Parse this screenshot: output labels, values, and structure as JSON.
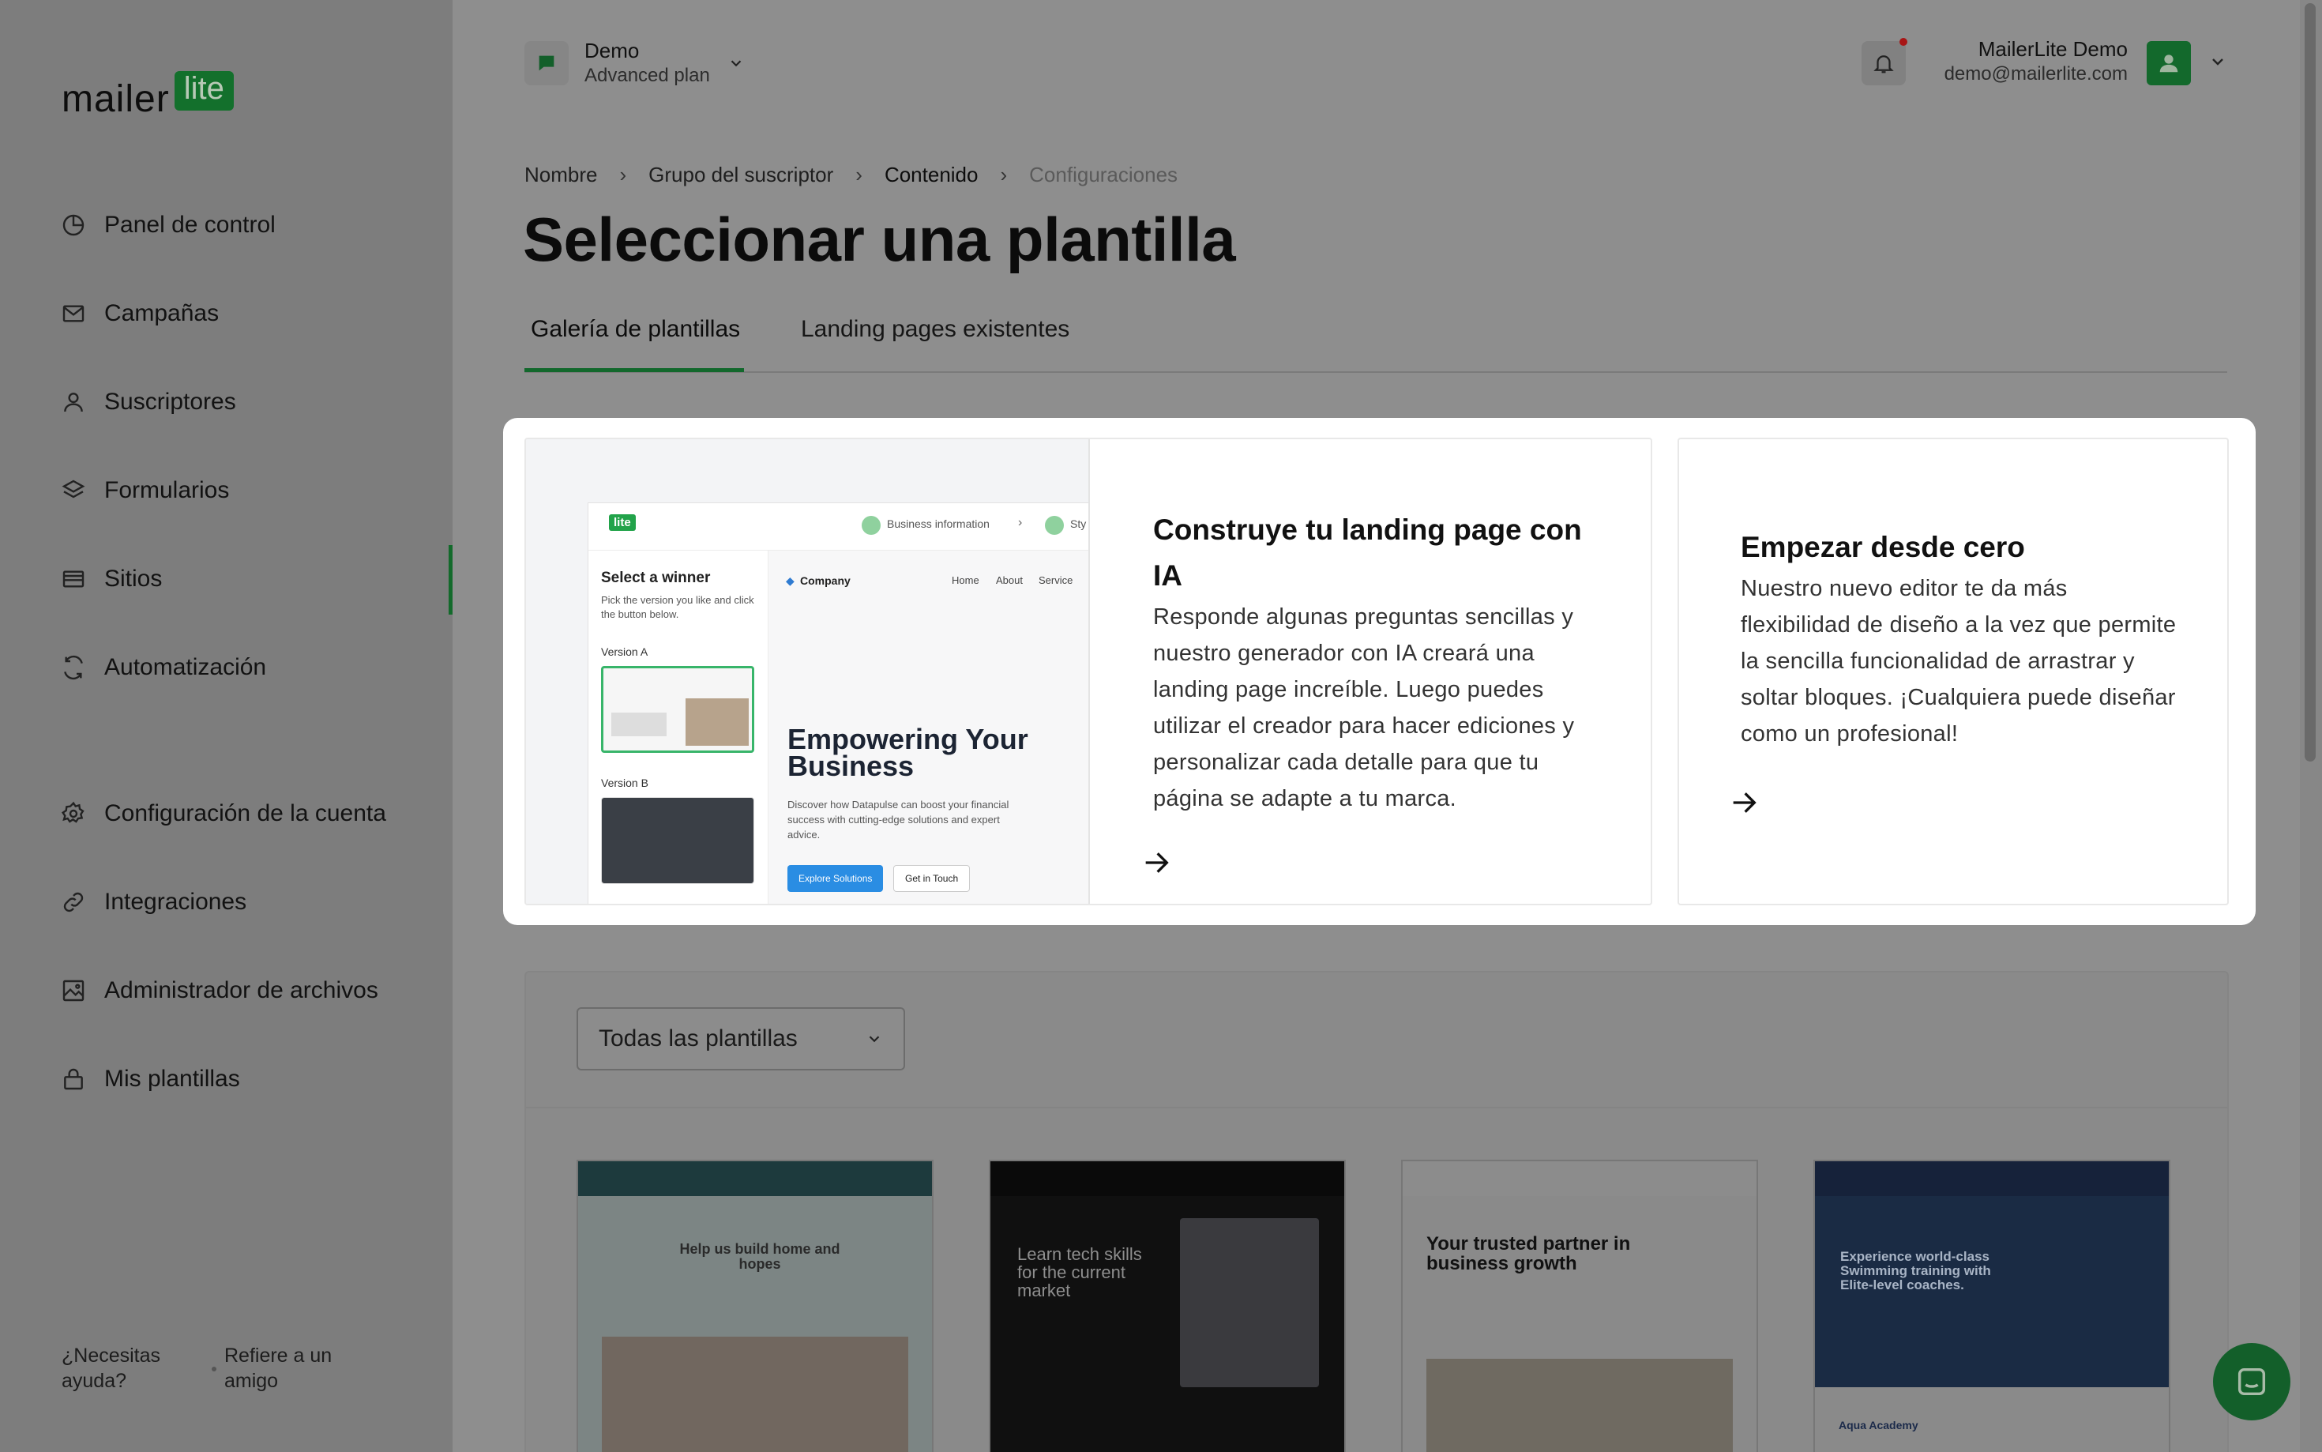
{
  "brand": {
    "logo_main": "mailer",
    "logo_badge": "lite"
  },
  "sidebar": {
    "items": [
      {
        "label": "Panel de control",
        "icon": "chart-pie-icon"
      },
      {
        "label": "Campañas",
        "icon": "mail-icon"
      },
      {
        "label": "Suscriptores",
        "icon": "user-icon"
      },
      {
        "label": "Formularios",
        "icon": "layers-icon"
      },
      {
        "label": "Sitios",
        "icon": "browser-icon",
        "active": true
      },
      {
        "label": "Automatización",
        "icon": "refresh-icon"
      },
      {
        "label": "Configuración de la cuenta",
        "icon": "gear-icon"
      },
      {
        "label": "Integraciones",
        "icon": "link-icon"
      },
      {
        "label": "Administrador de archivos",
        "icon": "image-icon"
      },
      {
        "label": "Mis plantillas",
        "icon": "lock-icon"
      }
    ],
    "help": "¿Necesitas ayuda?",
    "refer": "Refiere a un amigo"
  },
  "header": {
    "account_name": "Demo",
    "account_plan": "Advanced plan",
    "user_name": "MailerLite Demo",
    "user_email": "demo@mailerlite.com"
  },
  "breadcrumb": [
    "Nombre",
    "Grupo del suscriptor",
    "Contenido",
    "Configuraciones"
  ],
  "page_title": "Seleccionar una plantilla",
  "tabs": [
    "Galería de plantillas",
    "Landing pages existentes"
  ],
  "cards": {
    "ai": {
      "title": "Construye tu landing page con IA",
      "description": "Responde algunas preguntas sencillas y nuestro generador con IA creará una landing page increíble. Luego puedes utilizar el creador para hacer ediciones y personalizar cada detalle para que tu página se adapte a tu marca."
    },
    "blank": {
      "title": "Empezar desde cero",
      "description": "Nuestro nuevo editor te da más flexibilidad de diseño a la vez que permite la sencilla funcionalidad de arrastrar y soltar bloques. ¡Cualquiera puede diseñar como un profesional!"
    }
  },
  "preview": {
    "badge": "lite",
    "step1": "Business information",
    "step2": "Sty",
    "select_title": "Select a winner",
    "select_desc": "Pick the version you like and click the button below.",
    "version_a": "Version A",
    "version_b": "Version B",
    "company": "Company",
    "nav": [
      "Home",
      "About",
      "Service"
    ],
    "hero_title": "Empowering Your Business",
    "hero_desc": "Discover how Datapulse can boost your financial success with cutting-edge solutions and expert advice.",
    "btn_primary": "Explore Solutions",
    "btn_secondary": "Get in Touch"
  },
  "gallery": {
    "filter": "Todas las plantillas",
    "templates": [
      {
        "title": "Help us build home and hopes"
      },
      {
        "title": "Learn tech skills for the current market"
      },
      {
        "title": "Your trusted partner in business growth"
      },
      {
        "title": "Experience world-class Swimming training with Elite-level coaches.",
        "footer": "Aqua Academy"
      }
    ]
  },
  "colors": {
    "brand_green": "#13702c",
    "overlay": "#8e8e8e"
  }
}
